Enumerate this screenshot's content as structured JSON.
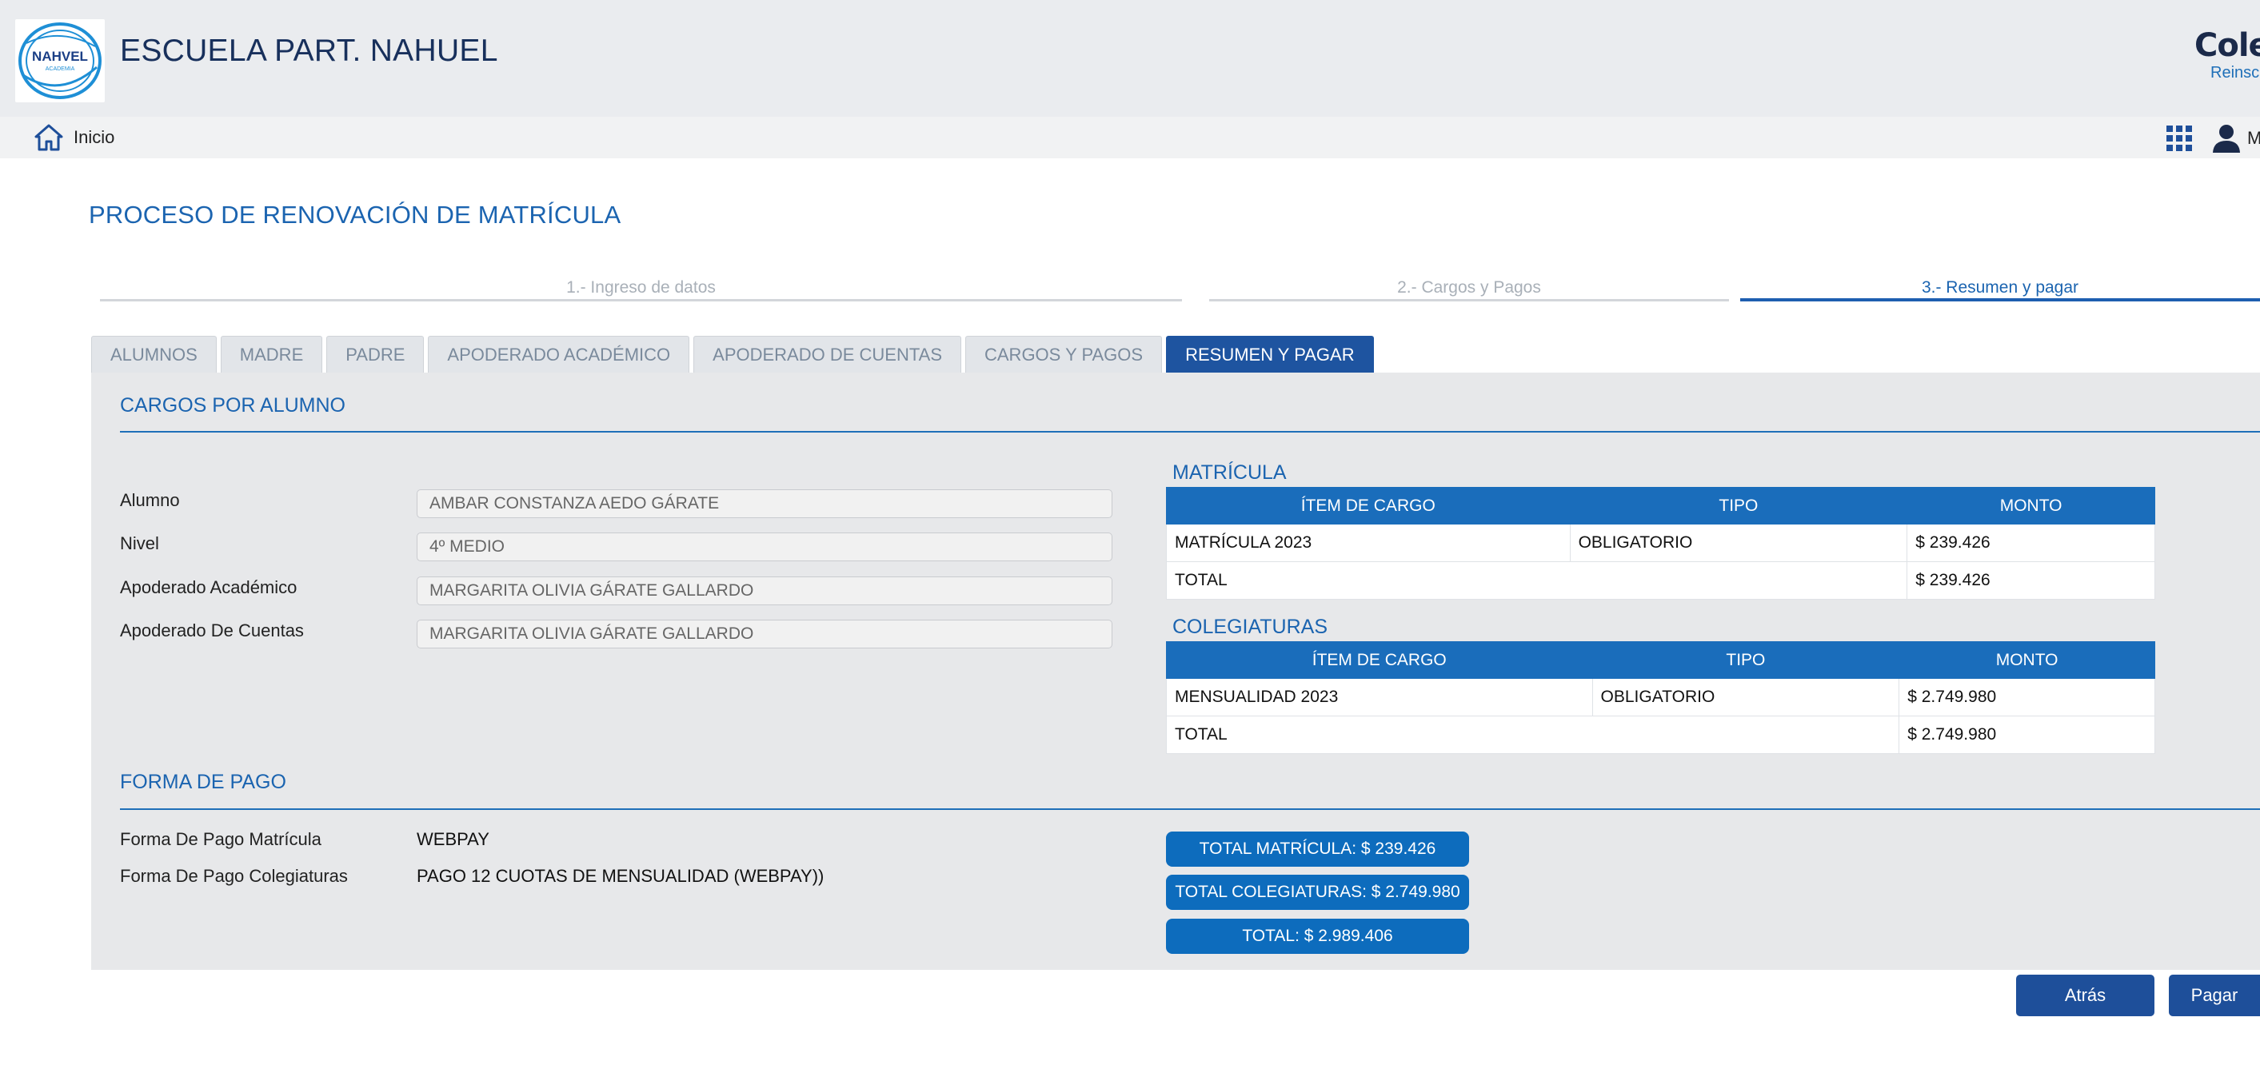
{
  "header": {
    "logo_text": "NAHVEL",
    "logo_subtext": "ACADEMIA",
    "school_name": "ESCUELA PART. NAHUEL",
    "brand": "Coleg",
    "brand_subtitle": "Reinscr"
  },
  "nav": {
    "home_label": "Inicio",
    "user_label": "M"
  },
  "page": {
    "title": "PROCESO DE RENOVACIÓN DE MATRÍCULA"
  },
  "steps": [
    {
      "label": "1.- Ingreso de datos",
      "active": false
    },
    {
      "label": "2.- Cargos y Pagos",
      "active": false
    },
    {
      "label": "3.- Resumen y pagar",
      "active": true
    }
  ],
  "tabs": [
    {
      "label": "ALUMNOS"
    },
    {
      "label": "MADRE"
    },
    {
      "label": "PADRE"
    },
    {
      "label": "APODERADO ACADÉMICO"
    },
    {
      "label": "APODERADO DE CUENTAS"
    },
    {
      "label": "CARGOS Y PAGOS"
    },
    {
      "label": "RESUMEN Y PAGAR"
    }
  ],
  "active_tab": "RESUMEN Y PAGAR",
  "charges_section": {
    "title": "CARGOS POR ALUMNO",
    "fields": [
      {
        "label": "Alumno",
        "value": "AMBAR CONSTANZA AEDO GÁRATE"
      },
      {
        "label": "Nivel",
        "value": "4º MEDIO"
      },
      {
        "label": "Apoderado Académico",
        "value": "MARGARITA OLIVIA GÁRATE GALLARDO"
      },
      {
        "label": "Apoderado De Cuentas",
        "value": "MARGARITA OLIVIA GÁRATE GALLARDO"
      }
    ]
  },
  "matricula": {
    "title": "MATRÍCULA",
    "headers": [
      "ÍTEM DE CARGO",
      "TIPO",
      "MONTO"
    ],
    "rows": [
      {
        "item": "MATRÍCULA 2023",
        "tipo": "OBLIGATORIO",
        "monto": "$ 239.426"
      }
    ],
    "total_label": "TOTAL",
    "total": "$ 239.426"
  },
  "colegiaturas": {
    "title": "COLEGIATURAS",
    "headers": [
      "ÍTEM DE CARGO",
      "TIPO",
      "MONTO"
    ],
    "rows": [
      {
        "item": "MENSUALIDAD 2023",
        "tipo": "OBLIGATORIO",
        "monto": "$ 2.749.980"
      }
    ],
    "total_label": "TOTAL",
    "total": "$ 2.749.980"
  },
  "payment": {
    "title": "FORMA DE PAGO",
    "matricula_label": "Forma De Pago Matrícula",
    "matricula_value": "WEBPAY",
    "colegiaturas_label": "Forma De Pago Colegiaturas",
    "colegiaturas_value": "PAGO 12 CUOTAS DE MENSUALIDAD (WEBPAY))"
  },
  "totals": {
    "matricula": "TOTAL MATRÍCULA: $ 239.426",
    "colegiaturas": "TOTAL COLEGIATURAS: $ 2.749.980",
    "total": "TOTAL: $ 2.989.406"
  },
  "buttons": {
    "back": "Atrás",
    "pay": "Pagar"
  },
  "colors": {
    "primary": "#1a6dbb",
    "tab_active": "#1e54a0",
    "title_blue": "#1b64b0",
    "panel_bg": "#e7e8ea"
  }
}
